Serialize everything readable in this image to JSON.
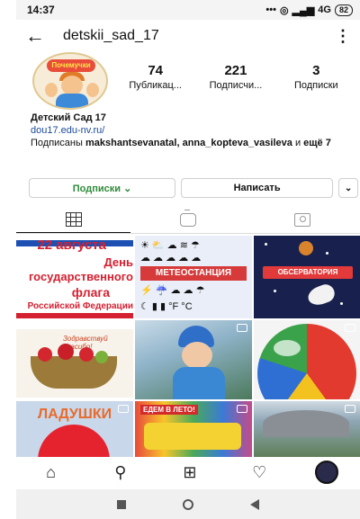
{
  "status_bar": {
    "time": "14:37",
    "network": "4G",
    "battery": "82"
  },
  "header": {
    "username": "detskii_sad_17"
  },
  "profile": {
    "logo_text": "Почемучки"
  },
  "stats": [
    {
      "value": "74",
      "label": "Публикац..."
    },
    {
      "value": "221",
      "label": "Подписчи..."
    },
    {
      "value": "3",
      "label": "Подписки"
    }
  ],
  "bio": {
    "name": "Детский Сад 17",
    "link": "dou17.edu-nv.ru/",
    "followed_prefix": "Подписаны ",
    "followed_names": "makshantsevanatal, anna_koptevа_vasileva",
    "followed_mid": " и ",
    "followed_more": "ещё 7"
  },
  "actions": {
    "follow_label": "Подписки ⌄",
    "message_label": "Написать",
    "suggest_label": "⌄"
  },
  "posts": {
    "p1_lines": [
      "22 августа",
      "День",
      "государственного",
      "флага",
      "Российской Федерации"
    ],
    "p2_label": "МЕТЕОСТАНЦИЯ",
    "p3_label": "ОБСЕРВАТОРИЯ",
    "p4_label": "Зодравствуй спасибо!",
    "p7_label": "ЛАДУШКИ",
    "p8_label": "ЕДЕМ В ЛЕТО!"
  },
  "icons": {
    "back": "arrow-left-icon",
    "more": "more-vertical-icon",
    "home": "home-icon",
    "search": "search-icon",
    "add": "add-post-icon",
    "heart": "heart-icon"
  }
}
